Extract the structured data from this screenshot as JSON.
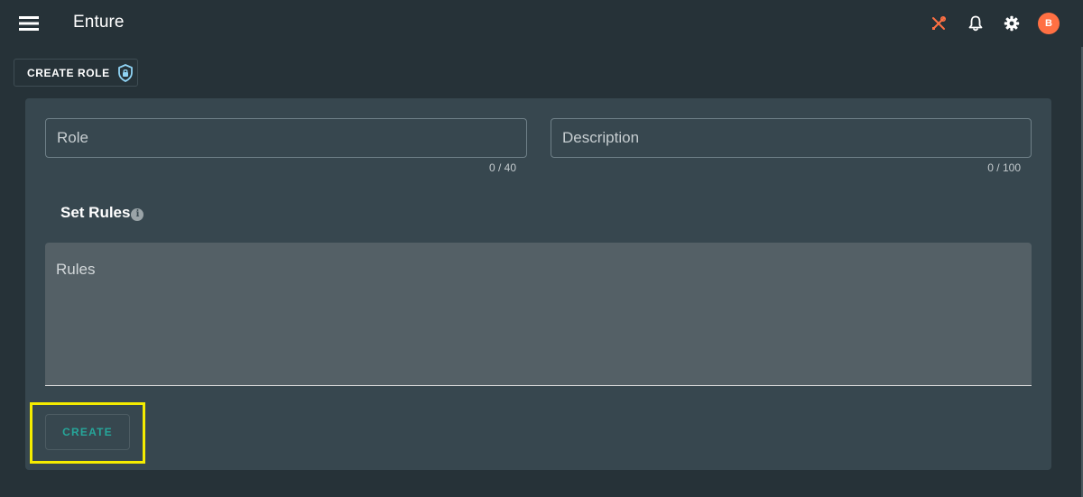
{
  "app": {
    "title": "Enture",
    "avatar_initial": "B",
    "icons": {
      "menu": "hamburger-menu-icon",
      "tools": "wrench-pencil-tools-icon",
      "notifications": "bell-icon",
      "settings": "gear-icon",
      "avatar": "user-avatar"
    },
    "colors": {
      "background": "#263238",
      "card": "#37474f",
      "accent": "#26a69a",
      "tools_icon": "#ff7043",
      "avatar": "#ff7043",
      "highlight": "#f5ec00"
    }
  },
  "page_chip": {
    "label": "CREATE ROLE",
    "icon": "shield-lock-icon"
  },
  "form": {
    "role": {
      "placeholder": "Role",
      "value": "",
      "counter": "0 / 40"
    },
    "description": {
      "placeholder": "Description",
      "value": "",
      "counter": "0 / 100"
    },
    "rules_section": {
      "title": "Set Rules",
      "info_icon": "info-icon"
    },
    "rules": {
      "placeholder": "Rules",
      "value": ""
    },
    "submit_label": "CREATE"
  }
}
